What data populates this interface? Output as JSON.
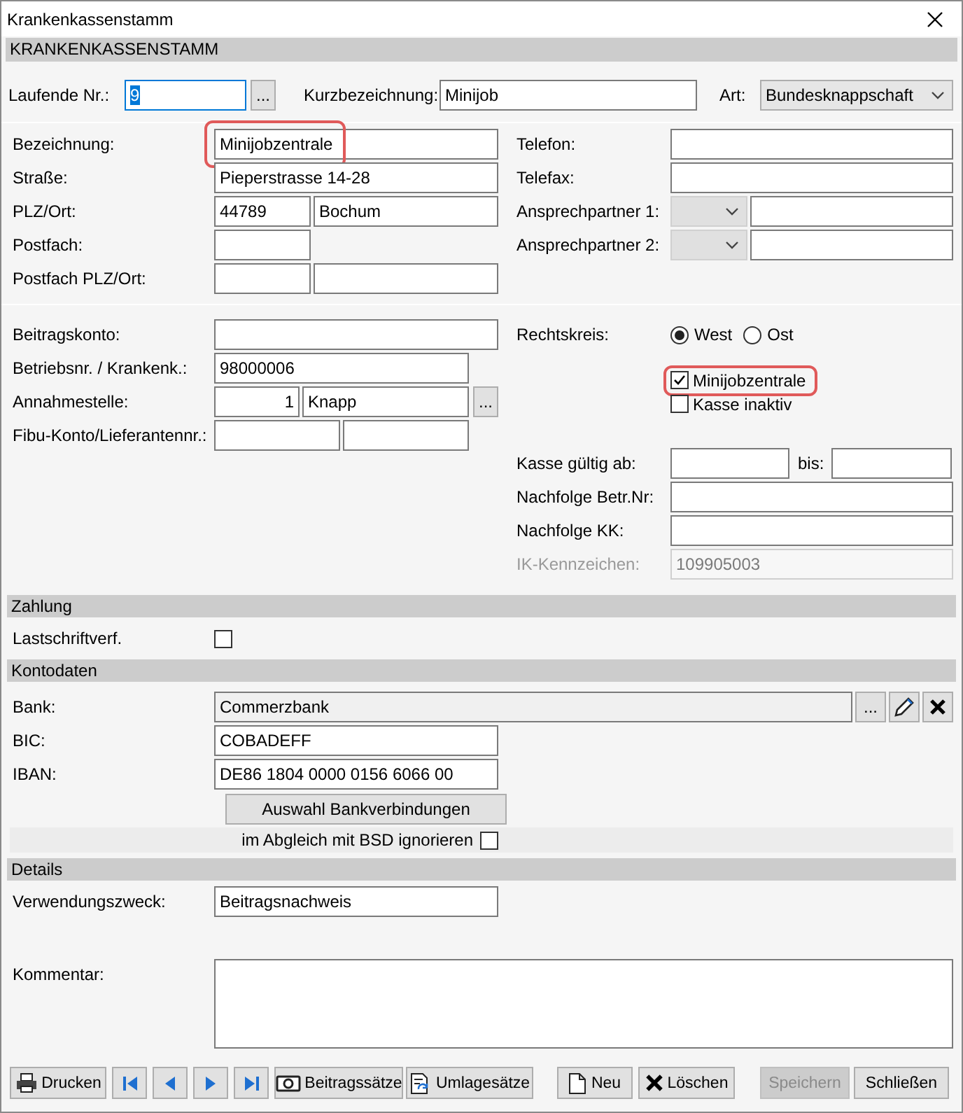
{
  "window": {
    "title": "Krankenkassenstamm"
  },
  "header": "KRANKENKASSENSTAMM",
  "top": {
    "laufende_nr": {
      "label": "Laufende Nr.:",
      "value": "9",
      "text_selected": true,
      "focused": true
    },
    "laufende_nr_browse": "...",
    "kurzbezeichnung": {
      "label": "Kurzbezeichnung:",
      "value": "Minijob"
    },
    "art": {
      "label": "Art:",
      "value": "Bundesknappschaft"
    }
  },
  "stammdaten": {
    "bezeichnung": {
      "label": "Bezeichnung:",
      "value": "Minijobzentrale",
      "highlighted": true
    },
    "strasse": {
      "label": "Straße:",
      "value": "Pieperstrasse 14-28"
    },
    "plz_ort": {
      "label": "PLZ/Ort:",
      "plz": "44789",
      "ort": "Bochum"
    },
    "postfach": {
      "label": "Postfach:"
    },
    "postfach_plz_ort": {
      "label": "Postfach PLZ/Ort:"
    },
    "telefon": {
      "label": "Telefon:"
    },
    "telefax": {
      "label": "Telefax:"
    },
    "ansprechpartner_1": {
      "label": "Ansprechpartner 1:",
      "disabled": true
    },
    "ansprechpartner_2": {
      "label": "Ansprechpartner 2:",
      "disabled": true
    }
  },
  "kasse": {
    "beitragskonto": {
      "label": "Beitragskonto:"
    },
    "betriebsnr": {
      "label": "Betriebsnr. / Krankenk.:",
      "value": "98000006"
    },
    "annahmestelle": {
      "label": "Annahmestelle:",
      "nummer": "1",
      "name": "Knapp",
      "browse": "..."
    },
    "fibu_konto": {
      "label": "Fibu-Konto/Lieferantennr.:"
    },
    "rechtskreis": {
      "label": "Rechtskreis:",
      "options": [
        {
          "label": "West",
          "selected": true
        },
        {
          "label": "Ost",
          "selected": false
        }
      ]
    },
    "minijobzentrale": {
      "label": "Minijobzentrale",
      "checked": true,
      "highlighted": true
    },
    "kasse_inaktiv": {
      "label": "Kasse inaktiv",
      "checked": false
    },
    "gueltig_ab": {
      "label": "Kasse gültig ab:",
      "bis_label": "bis:"
    },
    "nachfolge_betr_nr": {
      "label": "Nachfolge Betr.Nr:"
    },
    "nachfolge_kk": {
      "label": "Nachfolge KK:"
    },
    "ik_kennzeichen": {
      "label": "IK-Kennzeichen:",
      "value": "109905003",
      "disabled": true
    }
  },
  "zahlung": {
    "title": "Zahlung",
    "lastschrift": {
      "label": "Lastschriftverf.",
      "checked": false
    }
  },
  "kontodaten": {
    "title": "Kontodaten",
    "bank": {
      "label": "Bank:",
      "value": "Commerzbank",
      "browse": "..."
    },
    "bic": {
      "label": "BIC:",
      "value": "COBADEFF"
    },
    "iban": {
      "label": "IBAN:",
      "value": "DE86 1804 0000 0156 6066 00"
    },
    "auswahl_button": "Auswahl Bankverbindungen",
    "bsd_ignorieren": {
      "label": "im Abgleich mit BSD ignorieren",
      "checked": false
    }
  },
  "details": {
    "title": "Details",
    "verwendungszweck": {
      "label": "Verwendungszweck:",
      "value": "Beitragsnachweis"
    },
    "kommentar": {
      "label": "Kommentar:"
    }
  },
  "toolbar": [
    {
      "kind": "print",
      "label": "Drucken",
      "disabled": false
    },
    {
      "kind": "first",
      "disabled": false
    },
    {
      "kind": "prev",
      "disabled": false
    },
    {
      "kind": "next",
      "disabled": false
    },
    {
      "kind": "last",
      "disabled": false
    },
    {
      "kind": "rates",
      "label": "Beitragssätze",
      "disabled": false
    },
    {
      "kind": "levy",
      "label": "Umlagesätze",
      "disabled": false
    },
    {
      "kind": "new",
      "label": "Neu",
      "disabled": false
    },
    {
      "kind": "delete",
      "label": "Löschen",
      "disabled": false
    },
    {
      "kind": "save",
      "label": "Speichern",
      "disabled": true
    },
    {
      "kind": "close",
      "label": "Schließen",
      "disabled": false
    }
  ]
}
